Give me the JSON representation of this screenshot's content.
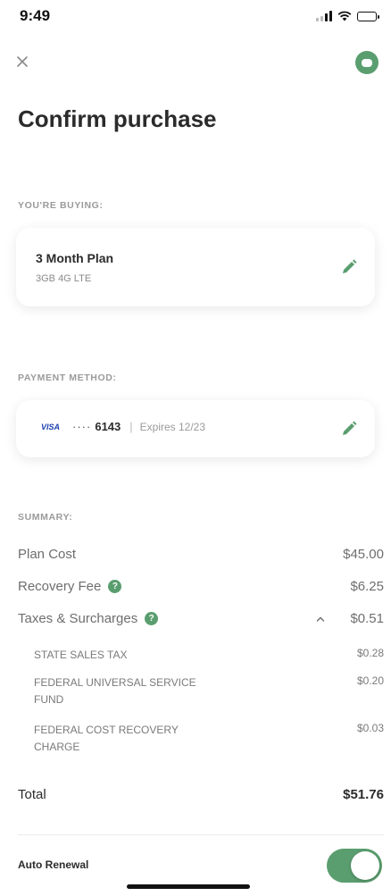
{
  "status_bar": {
    "time": "9:49"
  },
  "header": {
    "title": "Confirm purchase"
  },
  "buying": {
    "label": "YOU'RE BUYING:",
    "plan_name": "3 Month Plan",
    "plan_detail": "3GB 4G LTE"
  },
  "payment": {
    "label": "PAYMENT METHOD:",
    "card_brand": "VISA",
    "masked": "····",
    "last4": "6143",
    "separator": "|",
    "expires": "Expires 12/23"
  },
  "summary": {
    "label": "SUMMARY:",
    "plan_cost": {
      "label": "Plan Cost",
      "value": "$45.00"
    },
    "recovery_fee": {
      "label": "Recovery Fee",
      "value": "$6.25"
    },
    "taxes": {
      "label": "Taxes & Surcharges",
      "value": "$0.51",
      "items": [
        {
          "label": "STATE SALES TAX",
          "value": "$0.28"
        },
        {
          "label": "FEDERAL UNIVERSAL SERVICE FUND",
          "value": "$0.20"
        },
        {
          "label": "FEDERAL COST RECOVERY CHARGE",
          "value": "$0.03"
        }
      ]
    },
    "total": {
      "label": "Total",
      "value": "$51.76"
    }
  },
  "auto_renewal": {
    "label": "Auto Renewal",
    "enabled": true
  },
  "colors": {
    "accent": "#5a9e6f",
    "visa": "#1a3fb0"
  },
  "icons": {
    "close": "close-icon",
    "chat": "chat-icon",
    "edit": "pencil-icon",
    "help": "question-icon",
    "chevron": "chevron-up-icon"
  }
}
